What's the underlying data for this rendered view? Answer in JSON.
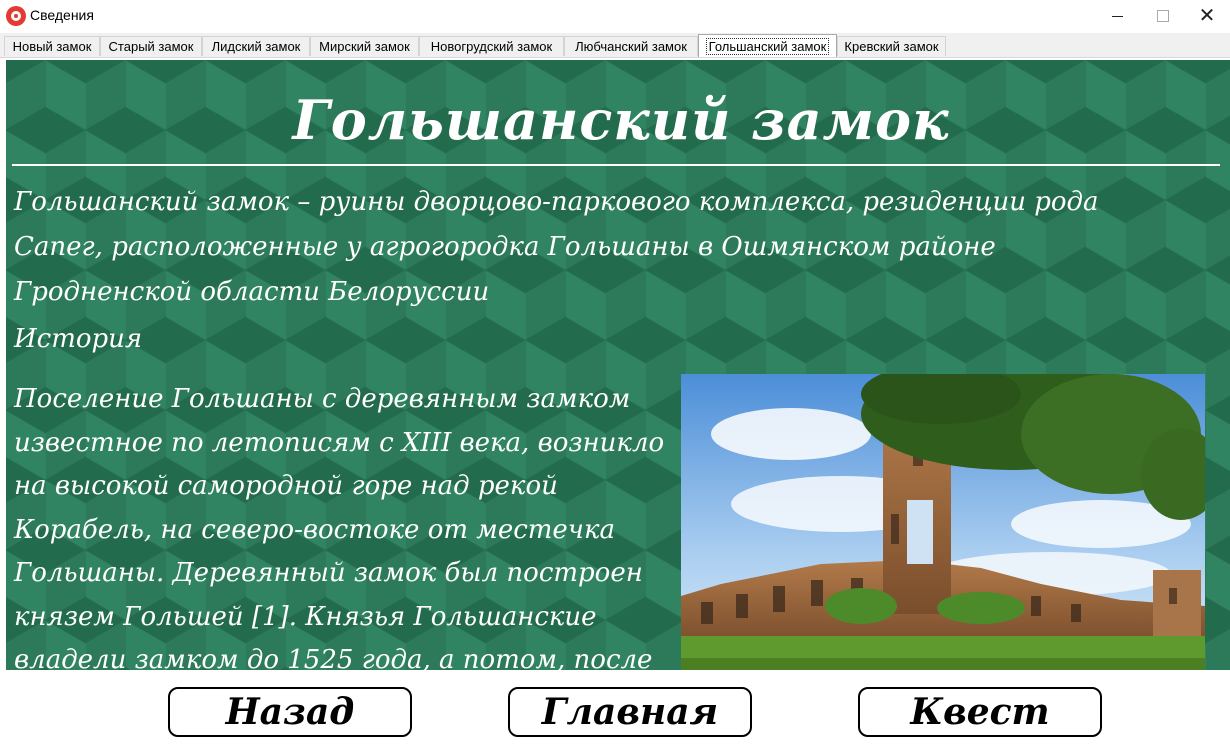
{
  "window": {
    "title": "Сведения",
    "icon": "app-logo-icon",
    "controls": [
      "minimize-icon",
      "maximize-icon",
      "close-icon"
    ]
  },
  "tabs": [
    {
      "label": "Новый замок",
      "active": false
    },
    {
      "label": "Старый замок",
      "active": false
    },
    {
      "label": "Лидский замок",
      "active": false
    },
    {
      "label": "Мирский замок",
      "active": false
    },
    {
      "label": "Новогрудский замок",
      "active": false
    },
    {
      "label": "Любчанский замок",
      "active": false
    },
    {
      "label": "Гольшанский замок",
      "active": true
    },
    {
      "label": "Кревский замок",
      "active": false
    }
  ],
  "content": {
    "title": "Гольшанский замок",
    "intro": "Гольшанский замок – руины дворцово-паркового комплекса, резиденции рода Сапег, расположенные у агрогородка Гольшаны в Ошмянском районе Гродненской области Белоруссии",
    "history_heading": "История",
    "history_text": "Поселение Гольшаны с деревянным замком известное по летописям с XIII века, возникло на высокой самородной горе над рекой Корабель, на северо-востоке от местечка Гольшаны. Деревянный замок был построен князем Гольшей [1]. Князья Гольшанские владели замком до 1525 года, а потом, после брака княжны Елены",
    "photo": "castle-ruins-photo"
  },
  "buttons": {
    "back": "Назад",
    "main": "Главная",
    "quest": "Квест"
  },
  "colors": {
    "background_green": "#2c7a5a",
    "accent_red": "#e53935",
    "text": "#ffffff"
  }
}
